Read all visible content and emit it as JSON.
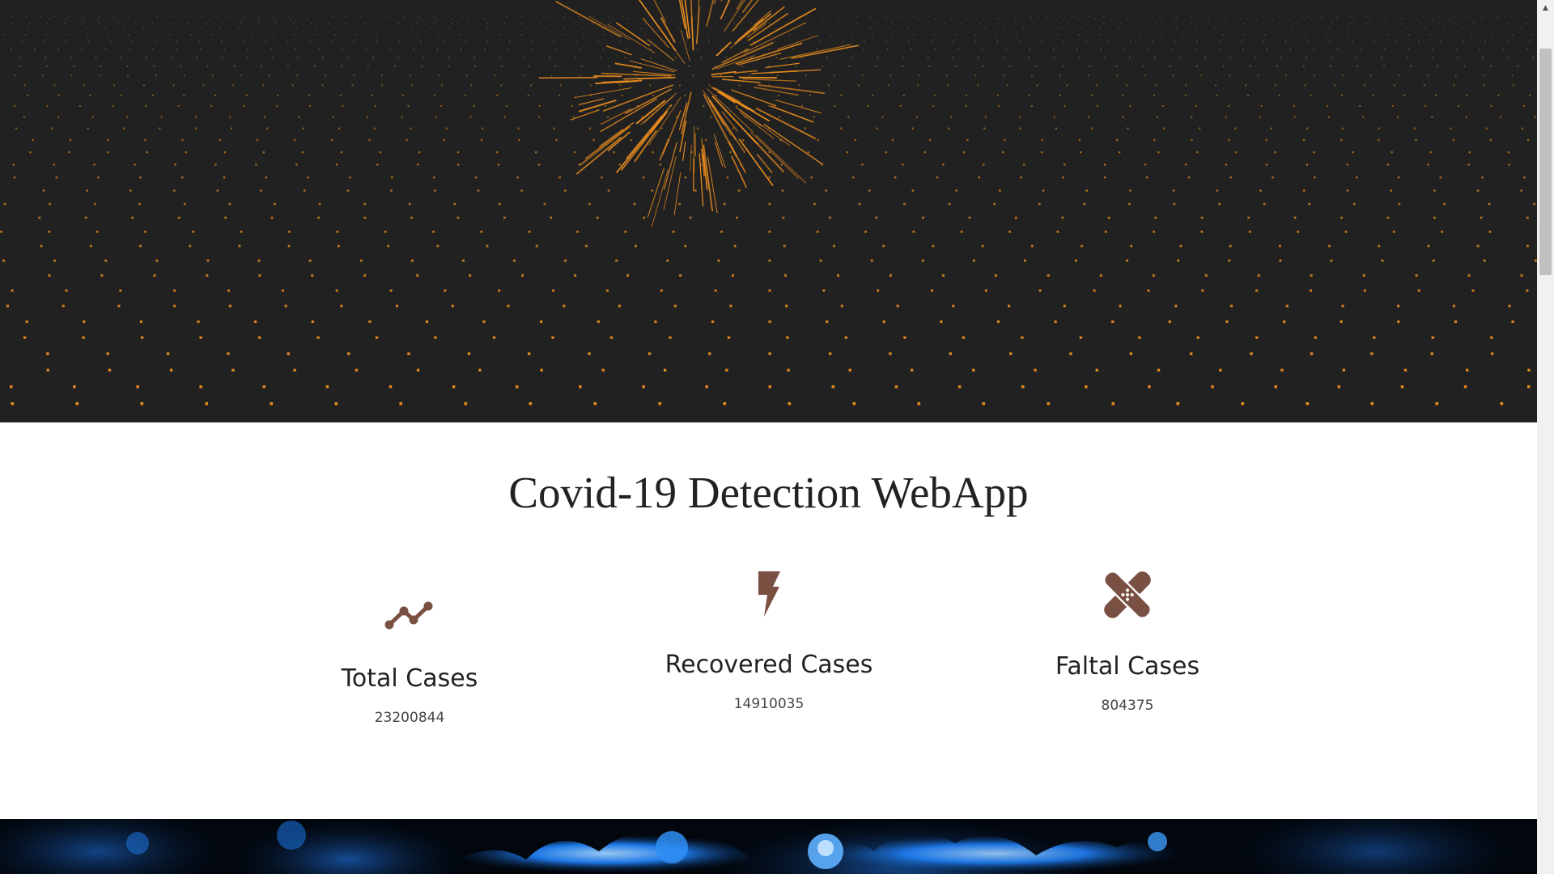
{
  "page": {
    "title": "Covid-19 Detection WebApp"
  },
  "stats": [
    {
      "icon": "trend-line-icon",
      "label": "Total Cases",
      "value": "23200844"
    },
    {
      "icon": "lightning-bolt-icon",
      "label": "Recovered Cases",
      "value": "14910035"
    },
    {
      "icon": "band-aid-icon",
      "label": "Faltal Cases",
      "value": "804375"
    }
  ],
  "colors": {
    "hero_background": "#212121",
    "particle_orange": "#f0901e",
    "icon_brown": "#7a5043",
    "text_dark": "#222222",
    "virus_blue": "#1e7cf0"
  },
  "scrollbar": {
    "up_arrow": "▲"
  }
}
